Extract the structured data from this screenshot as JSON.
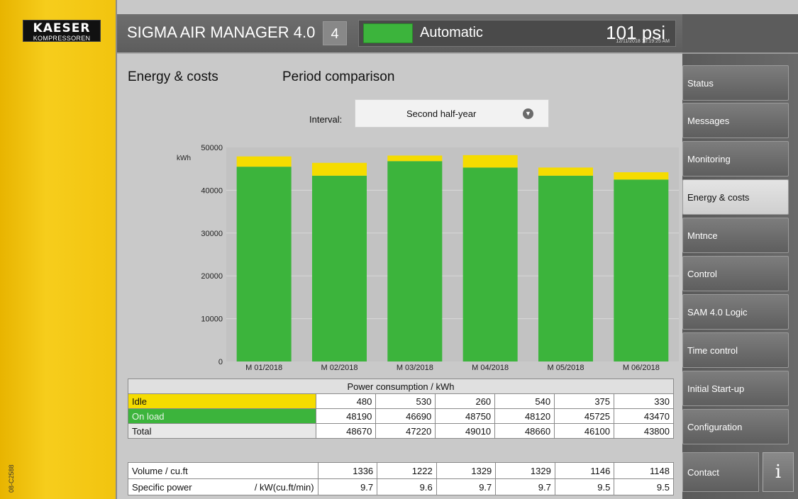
{
  "brand": {
    "logo_line1": "KAESER",
    "logo_line2": "KOMPRESSOREN"
  },
  "side_code": "08-C2588",
  "header": {
    "title": "SIGMA AIR MANAGER 4.0",
    "number": "4",
    "mode": "Automatic",
    "pressure": "101 psi",
    "datetime": "12/11/2018 10:19:25 AM",
    "status_color": "#3cb43c"
  },
  "page": {
    "title": "Energy & costs",
    "subtitle": "Period comparison",
    "interval_label": "Interval:",
    "interval_value": "Second half-year"
  },
  "nav": {
    "items": [
      {
        "label": "Status",
        "active": false
      },
      {
        "label": "Messages",
        "active": false
      },
      {
        "label": "Monitoring",
        "active": false
      },
      {
        "label": "Energy & costs",
        "active": true
      },
      {
        "label": "Mntnce",
        "active": false
      },
      {
        "label": "Control",
        "active": false
      },
      {
        "label": "SAM 4.0 Logic",
        "active": false
      },
      {
        "label": "Time control",
        "active": false
      },
      {
        "label": "Initial Start-up",
        "active": false
      },
      {
        "label": "Configuration",
        "active": false
      }
    ],
    "contact": "Contact",
    "info": "i"
  },
  "chart_data": {
    "type": "bar",
    "stacked": true,
    "ylabel": "kWh",
    "ylim": [
      0,
      50000
    ],
    "yticks": [
      0,
      10000,
      20000,
      30000,
      40000,
      50000
    ],
    "categories": [
      "M 01/2018",
      "M 02/2018",
      "M 03/2018",
      "M 04/2018",
      "M 05/2018",
      "M 06/2018"
    ],
    "series": [
      {
        "name": "On load",
        "color": "#3cb43c",
        "values": [
          45500,
          43400,
          46800,
          45300,
          43400,
          42500
        ]
      },
      {
        "name": "Idle",
        "color": "#f5dc00",
        "values": [
          2400,
          3000,
          1300,
          2900,
          1900,
          1700
        ]
      }
    ],
    "grid": true
  },
  "table": {
    "header": "Power consumption / kWh",
    "rows": [
      {
        "label": "Idle",
        "values": [
          "480",
          "530",
          "260",
          "540",
          "375",
          "330"
        ]
      },
      {
        "label": "On load",
        "values": [
          "48190",
          "46690",
          "48750",
          "48120",
          "45725",
          "43470"
        ]
      },
      {
        "label": "Total",
        "values": [
          "48670",
          "47220",
          "49010",
          "48660",
          "46100",
          "43800"
        ]
      }
    ]
  },
  "table2": {
    "rows": [
      {
        "label": "Volume  / cu.ft",
        "unit": "",
        "values": [
          "1336",
          "1222",
          "1329",
          "1329",
          "1146",
          "1148"
        ]
      },
      {
        "label": "Specific power",
        "unit": "/ kW(cu.ft/min)",
        "values": [
          "9.7",
          "9.6",
          "9.7",
          "9.7",
          "9.5",
          "9.5"
        ]
      }
    ]
  }
}
